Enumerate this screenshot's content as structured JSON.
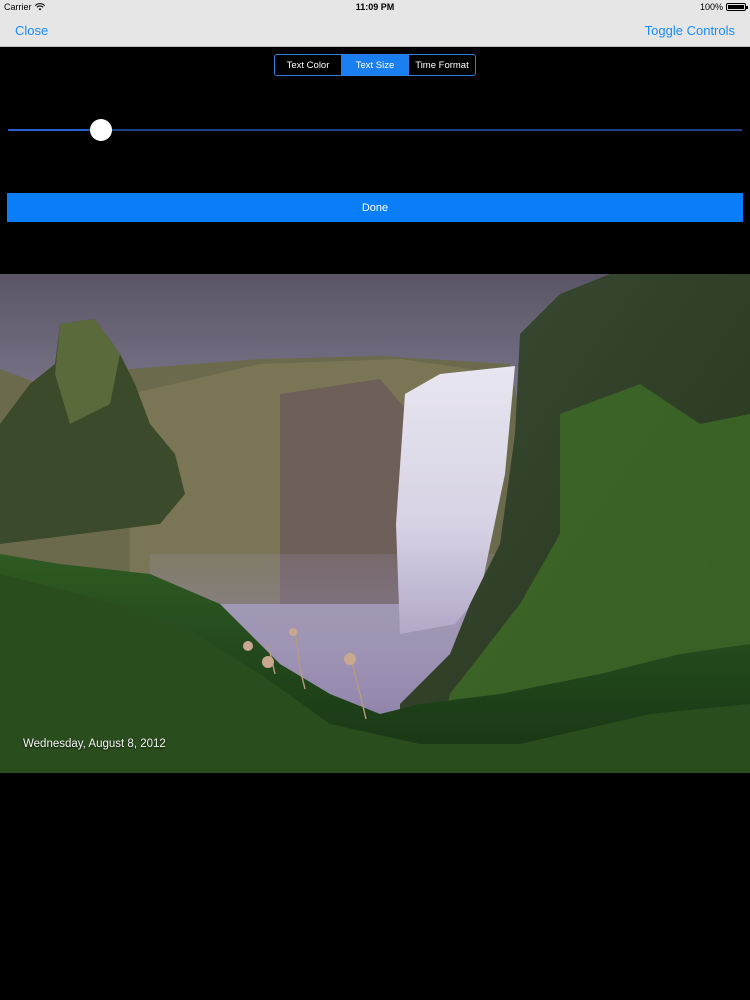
{
  "status_bar": {
    "carrier": "Carrier",
    "time": "11:09 PM",
    "battery": "100%"
  },
  "nav": {
    "close_label": "Close",
    "toggle_label": "Toggle Controls"
  },
  "segmented": {
    "options": [
      "Text Color",
      "Text Size",
      "Time Format"
    ],
    "selected_index": 1
  },
  "slider": {
    "value": 0.127
  },
  "done_label": "Done",
  "photo": {
    "date_text": "Wednesday, August 8, 2012"
  },
  "colors": {
    "accent": "#1a8cff",
    "done_button": "#0a7df8",
    "background": "#000000",
    "nav_background": "#e6e6e6"
  },
  "icons": {
    "wifi": "wifi-icon",
    "battery": "battery-icon"
  }
}
